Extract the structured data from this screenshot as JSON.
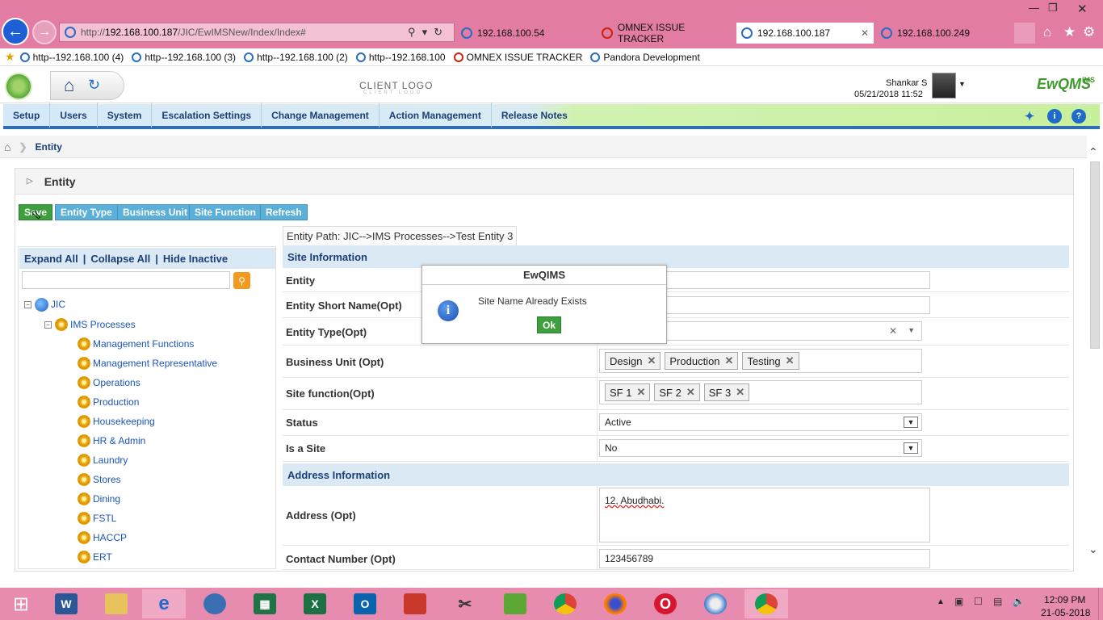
{
  "browser": {
    "url_prefix": "http://",
    "url_host": "192.168.100.187",
    "url_path": "/JIC/EwIMSNew/Index/Index#",
    "tabs": [
      {
        "label": "192.168.100.54"
      },
      {
        "label": "OMNEX ISSUE TRACKER"
      },
      {
        "label": "192.168.100.187",
        "active": true
      },
      {
        "label": "192.168.100.249"
      }
    ],
    "favorites": [
      "http--192.168.100 (4)",
      "http--192.168.100 (3)",
      "http--192.168.100 (2)",
      "http--192.168.100",
      "OMNEX ISSUE TRACKER",
      "Pandora Development"
    ]
  },
  "header": {
    "client_logo": "CLIENT LOGO",
    "client_logo_sub": "CLIENT LOGO",
    "user_name": "Shankar S",
    "datetime": "05/21/2018 11:52",
    "brand": "EwQMS",
    "brand_sup": "IMS"
  },
  "menu": {
    "items": [
      "Setup",
      "Users",
      "System",
      "Escalation Settings",
      "Change Management",
      "Action Management",
      "Release Notes"
    ]
  },
  "breadcrumb": {
    "current": "Entity"
  },
  "panel": {
    "title": "Entity"
  },
  "toolbar": {
    "save": "Save",
    "entity_type": "Entity Type",
    "business_unit": "Business Unit",
    "site_function": "Site Function",
    "refresh": "Refresh"
  },
  "tree": {
    "expand_all": "Expand All",
    "sep": "|",
    "collapse_all": "Collapse All",
    "hide_inactive": "Hide Inactive",
    "search_value": "",
    "root": "JIC",
    "group": "IMS Processes",
    "children": [
      "Management Functions",
      "Management Representative",
      "Operations",
      "Production",
      "Housekeeping",
      "HR & Admin",
      "Laundry",
      "Stores",
      "Dining",
      "FSTL",
      "HACCP",
      "ERT"
    ]
  },
  "form": {
    "entity_path": "Entity Path: JIC-->IMS Processes-->Test Entity 3",
    "site_section": "Site Information",
    "labels": {
      "entity": "Entity",
      "short_name": "Entity Short Name(Opt)",
      "entity_type": "Entity Type(Opt)",
      "business_unit": "Business Unit (Opt)",
      "site_function": "Site function(Opt)",
      "status": "Status",
      "is_site": "Is a Site",
      "address": "Address (Opt)",
      "contact": "Contact Number (Opt)"
    },
    "business_units": [
      "Design",
      "Production",
      "Testing"
    ],
    "site_functions": [
      "SF 1",
      "SF 2",
      "SF 3"
    ],
    "status_value": "Active",
    "is_site_value": "No",
    "address_section": "Address Information",
    "address_value": "12, Abudhabi.",
    "contact_value": "123456789"
  },
  "modal": {
    "title": "EwQIMS",
    "message": "Site Name Already Exists",
    "ok": "Ok"
  },
  "taskbar": {
    "time": "12:09 PM",
    "date": "21-05-2018"
  },
  "colors": {
    "titlebar": "#e27ca3",
    "menu_border": "#2f6db5",
    "save_green": "#3d9f3d",
    "toolbar_blue": "#5ab0d8"
  }
}
